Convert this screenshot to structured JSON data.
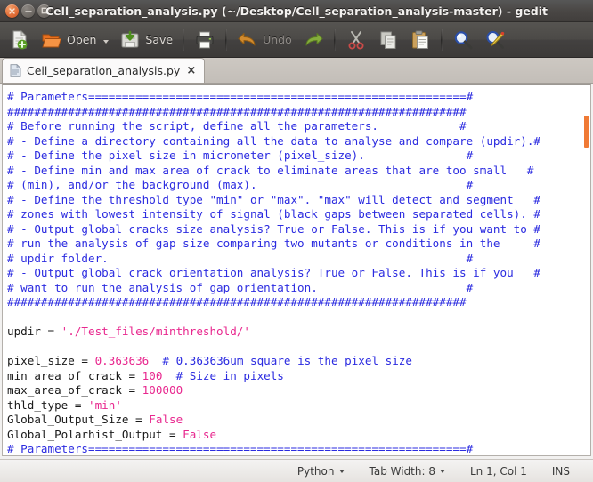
{
  "window": {
    "title": "Cell_separation_analysis.py (~/Desktop/Cell_separation_analysis-master) - gedit",
    "close_label": "×",
    "minimize_label": "−",
    "maximize_label": "□"
  },
  "toolbar": {
    "new_label": "",
    "open_label": "Open",
    "save_label": "Save",
    "print_label": "",
    "undo_label": "Undo",
    "redo_label": "",
    "cut_label": "",
    "copy_label": "",
    "paste_label": "",
    "find_label": "",
    "replace_label": "",
    "icons": {
      "new": "new-document-icon",
      "open": "open-folder-icon",
      "open_dropdown": "chevron-down-icon",
      "save": "save-disk-icon",
      "print": "printer-icon",
      "undo": "undo-arrow-icon",
      "redo": "redo-arrow-icon",
      "cut": "scissors-icon",
      "copy": "copy-icon",
      "paste": "clipboard-paste-icon",
      "find": "magnifier-icon",
      "replace": "find-replace-icon"
    }
  },
  "tabs": [
    {
      "label": "Cell_separation_analysis.py",
      "close": "×",
      "icon": "text-file-icon",
      "active": true
    }
  ],
  "editor": {
    "lines": [
      [
        {
          "t": "# Parameters========================================================#",
          "c": "comment"
        }
      ],
      [
        {
          "t": "####################################################################",
          "c": "comment"
        }
      ],
      [
        {
          "t": "# Before running the script, define all the parameters.            #",
          "c": "comment"
        }
      ],
      [
        {
          "t": "# - Define a directory containing all the data to analyse and compare (updir).#",
          "c": "comment"
        }
      ],
      [
        {
          "t": "# - Define the pixel size in micrometer (pixel_size).               #",
          "c": "comment"
        }
      ],
      [
        {
          "t": "# - Define min and max area of crack to eliminate areas that are too small   #",
          "c": "comment"
        }
      ],
      [
        {
          "t": "# (min), and/or the background (max).                               #",
          "c": "comment"
        }
      ],
      [
        {
          "t": "# - Define the threshold type \"min\" or \"max\". \"max\" will detect and segment   #",
          "c": "comment"
        }
      ],
      [
        {
          "t": "# zones with lowest intensity of signal (black gaps between separated cells). #",
          "c": "comment"
        }
      ],
      [
        {
          "t": "# - Output global cracks size analysis? True or False. This is if you want to #",
          "c": "comment"
        }
      ],
      [
        {
          "t": "# run the analysis of gap size comparing two mutants or conditions in the     #",
          "c": "comment"
        }
      ],
      [
        {
          "t": "# updir folder.                                                     #",
          "c": "comment"
        }
      ],
      [
        {
          "t": "# - Output global crack orientation analysis? True or False. This is if you   #",
          "c": "comment"
        }
      ],
      [
        {
          "t": "# want to run the analysis of gap orientation.                      #",
          "c": "comment"
        }
      ],
      [
        {
          "t": "####################################################################",
          "c": "comment"
        }
      ],
      [],
      [
        {
          "t": "updir = ",
          "c": "plain"
        },
        {
          "t": "'./Test_files/minthreshold/'",
          "c": "string"
        }
      ],
      [],
      [
        {
          "t": "pixel_size = ",
          "c": "plain"
        },
        {
          "t": "0.363636",
          "c": "number"
        },
        {
          "t": "  ",
          "c": "plain"
        },
        {
          "t": "# 0.363636um square is the pixel size",
          "c": "comment"
        }
      ],
      [
        {
          "t": "min_area_of_crack = ",
          "c": "plain"
        },
        {
          "t": "100",
          "c": "number"
        },
        {
          "t": "  ",
          "c": "plain"
        },
        {
          "t": "# Size in pixels",
          "c": "comment"
        }
      ],
      [
        {
          "t": "max_area_of_crack = ",
          "c": "plain"
        },
        {
          "t": "100000",
          "c": "number"
        }
      ],
      [
        {
          "t": "thld_type = ",
          "c": "plain"
        },
        {
          "t": "'min'",
          "c": "string"
        }
      ],
      [
        {
          "t": "Global_Output_Size = ",
          "c": "plain"
        },
        {
          "t": "False",
          "c": "keyword"
        }
      ],
      [
        {
          "t": "Global_Polarhist_Output = ",
          "c": "plain"
        },
        {
          "t": "False",
          "c": "keyword"
        }
      ],
      [
        {
          "t": "# Parameters========================================================#",
          "c": "comment"
        }
      ]
    ],
    "scroll_thumb": "vertical-scrollbar-thumb"
  },
  "statusbar": {
    "language": "Python",
    "tab_width": "Tab Width: 8",
    "position": "Ln 1, Col 1",
    "insert_mode": "INS"
  },
  "colors": {
    "comment": "#2b2be0",
    "string": "#e8278e",
    "number": "#e8278e",
    "keyword": "#e8278e",
    "accent_orange": "#f07a35",
    "titlebar": "#454240"
  }
}
